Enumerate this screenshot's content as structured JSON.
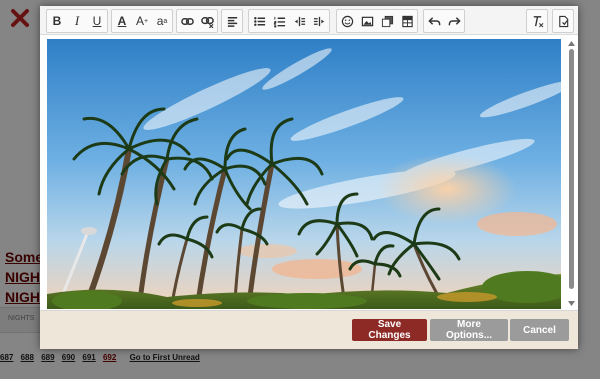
{
  "background_page": {
    "link_1": "Some",
    "link_2": "NIGH",
    "link_3": "NIGH",
    "small_text": "NIGHTS",
    "pager": {
      "pages": [
        "687",
        "688",
        "689",
        "690",
        "691"
      ],
      "current_page": "692",
      "first_unread": "Go to First Unread"
    }
  },
  "toolbar": {
    "bold": "B",
    "italic": "I",
    "underline": "U",
    "font_color": "A",
    "superscript": "A",
    "subscript": "a",
    "icons": [
      "bold-icon",
      "italic-icon",
      "underline-icon",
      "font-color-icon",
      "superscript-icon",
      "subscript-icon",
      "link-icon",
      "unlink-icon",
      "align-left-icon",
      "bullet-list-icon",
      "numbered-list-icon",
      "outdent-icon",
      "indent-icon",
      "emoji-icon",
      "image-icon",
      "copy-icon",
      "table-icon",
      "undo-icon",
      "redo-icon",
      "clear-format-icon",
      "source-icon"
    ]
  },
  "editor": {
    "image": "palm-trees-photo"
  },
  "footer": {
    "save_label": "Save Changes",
    "more_label": "More Options...",
    "cancel_label": "Cancel"
  },
  "colors": {
    "save_button": "#8e2a26",
    "secondary_button": "#9b9b9b",
    "footer_bg": "#efe6da",
    "background_link": "#6b0000"
  }
}
